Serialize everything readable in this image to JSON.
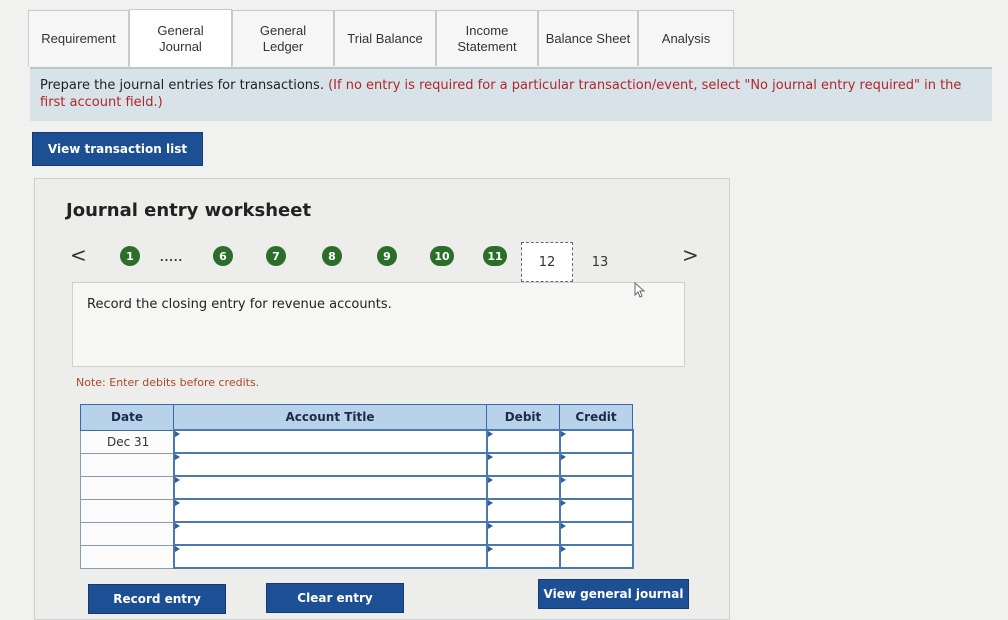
{
  "tabs": [
    {
      "label": "Requirement",
      "active": false
    },
    {
      "label": "General\nJournal",
      "active": true
    },
    {
      "label": "General\nLedger",
      "active": false
    },
    {
      "label": "Trial Balance",
      "active": false
    },
    {
      "label": "Income\nStatement",
      "active": false
    },
    {
      "label": "Balance Sheet",
      "active": false
    },
    {
      "label": "Analysis",
      "active": false
    }
  ],
  "instructions": {
    "lead": "Prepare the journal entries for transactions.",
    "paren": "(If no entry is required for a particular transaction/event, select \"No journal entry required\" in the first account field.)"
  },
  "view_transaction_list": "View transaction list",
  "worksheet": {
    "title": "Journal entry worksheet",
    "prev_arrow": "<",
    "next_arrow": ">",
    "steps_completed": [
      "1",
      "6",
      "7",
      "8",
      "9",
      "10",
      "11"
    ],
    "ellipsis": ".....",
    "current_step": "12",
    "next_step": "13",
    "description": "Record the closing entry for revenue accounts.",
    "note": "Note: Enter debits before credits."
  },
  "table": {
    "headers": {
      "date": "Date",
      "account": "Account Title",
      "debit": "Debit",
      "credit": "Credit"
    },
    "rows": [
      {
        "date": "Dec 31",
        "account": "",
        "debit": "",
        "credit": ""
      },
      {
        "date": "",
        "account": "",
        "debit": "",
        "credit": ""
      },
      {
        "date": "",
        "account": "",
        "debit": "",
        "credit": ""
      },
      {
        "date": "",
        "account": "",
        "debit": "",
        "credit": ""
      },
      {
        "date": "",
        "account": "",
        "debit": "",
        "credit": ""
      },
      {
        "date": "",
        "account": "",
        "debit": "",
        "credit": ""
      }
    ]
  },
  "buttons": {
    "record": "Record entry",
    "clear": "Clear entry",
    "view_journal": "View general journal"
  },
  "colors": {
    "primary_button": "#1c4f94",
    "step_done": "#2a6e2a",
    "header_blue": "#b8d2ea"
  }
}
